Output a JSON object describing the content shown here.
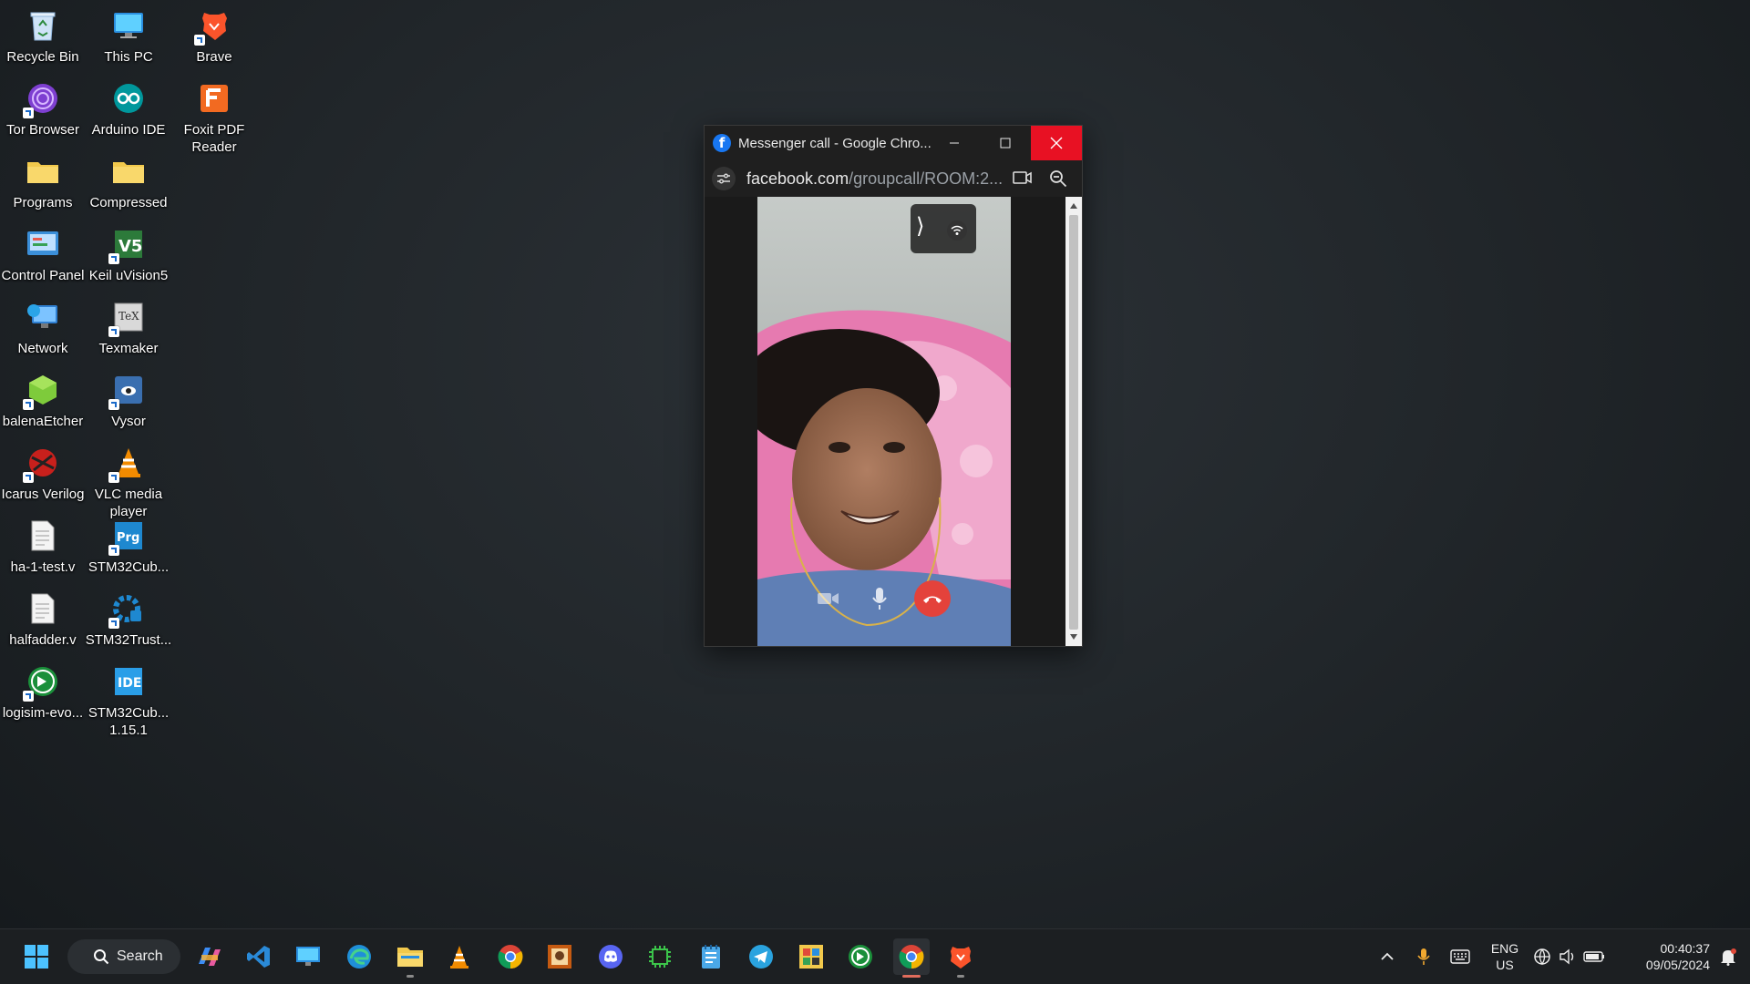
{
  "desktop": {
    "icons": [
      {
        "label": "Recycle Bin",
        "icon": "recycle-bin-icon"
      },
      {
        "label": "This PC",
        "icon": "computer-icon"
      },
      {
        "label": "Brave",
        "icon": "brave-icon"
      },
      {
        "label": "Tor Browser",
        "icon": "tor-browser-icon"
      },
      {
        "label": "Arduino IDE",
        "icon": "arduino-icon"
      },
      {
        "label": "Foxit PDF\nReader",
        "icon": "foxit-reader-icon"
      },
      {
        "label": "Programs",
        "icon": "folder-icon"
      },
      {
        "label": "Compressed",
        "icon": "folder-icon"
      },
      {
        "label": "Control Panel",
        "icon": "control-panel-icon"
      },
      {
        "label": "Keil uVision5",
        "icon": "keil-icon"
      },
      {
        "label": "Network",
        "icon": "network-icon"
      },
      {
        "label": "Texmaker",
        "icon": "texmaker-icon"
      },
      {
        "label": "balenaEtcher",
        "icon": "balena-etcher-icon"
      },
      {
        "label": "Vysor",
        "icon": "vysor-icon"
      },
      {
        "label": "Icarus Verilog",
        "icon": "icarus-verilog-icon"
      },
      {
        "label": "VLC media\nplayer",
        "icon": "vlc-icon"
      },
      {
        "label": "ha-1-test.v",
        "icon": "text-file-icon"
      },
      {
        "label": "STM32Cub...",
        "icon": "stm32-programmer-icon"
      },
      {
        "label": "halfadder.v",
        "icon": "text-file-icon"
      },
      {
        "label": "STM32Trust...",
        "icon": "stm32-trust-icon"
      },
      {
        "label": "logisim-evo...",
        "icon": "logisim-icon"
      },
      {
        "label": "STM32Cub...\n1.15.1",
        "icon": "stm32-ide-icon"
      }
    ]
  },
  "window": {
    "title": "Messenger call - Google Chro...",
    "url_main": "facebook.com",
    "url_rest": "/groupcall/ROOM:2...",
    "expand_glyph": "⟩"
  },
  "taskbar": {
    "search_label": "Search",
    "lang": "ENG",
    "region": "US",
    "time": "00:40:37",
    "date": "09/05/2024"
  }
}
